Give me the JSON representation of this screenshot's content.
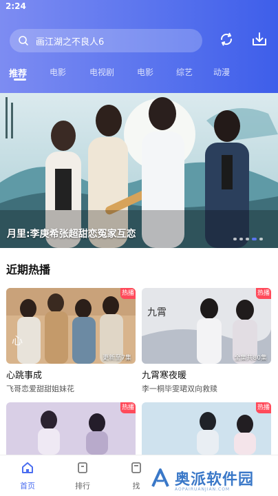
{
  "status_bar": {
    "time": "2:24"
  },
  "search": {
    "query": "画江湖之不良人6"
  },
  "header_icons": [
    "refresh-icon",
    "download-icon"
  ],
  "tabs": [
    {
      "label": "推荐",
      "active": true
    },
    {
      "label": "电影",
      "active": false
    },
    {
      "label": "电视剧",
      "active": false
    },
    {
      "label": "电影",
      "active": false
    },
    {
      "label": "综艺",
      "active": false
    },
    {
      "label": "动漫",
      "active": false
    }
  ],
  "banner": {
    "caption": "月里:李庚希张超甜恋冤家互恋",
    "dots": 5,
    "active_dot": 4
  },
  "section": {
    "title": "近期热播"
  },
  "cards": [
    {
      "title": "心跳事成",
      "desc": "飞哥恋爱甜甜姐妹花",
      "badge": "热播",
      "episode": "更新至7集"
    },
    {
      "title": "九霄寒夜暖",
      "desc": "李一桐毕雯珺双向救赎",
      "badge": "热播",
      "episode": "全集共80集"
    },
    {
      "title": "",
      "desc": "",
      "badge": "热播",
      "episode": ""
    },
    {
      "title": "",
      "desc": "",
      "badge": "热播",
      "episode": ""
    }
  ],
  "bottom_nav": [
    {
      "label": "首页",
      "icon": "home-icon",
      "active": true
    },
    {
      "label": "排行",
      "icon": "ranking-icon",
      "active": false
    },
    {
      "label": "找",
      "icon": "find-icon",
      "active": false
    }
  ],
  "watermark": {
    "text": "奥派软件园",
    "sub": "AOPAIRUANJIAN.COM"
  },
  "colors": {
    "accent": "#4a6df0",
    "header_start": "#7d8cf2",
    "header_end": "#3e5eea",
    "badge": "#ff4a5a"
  }
}
